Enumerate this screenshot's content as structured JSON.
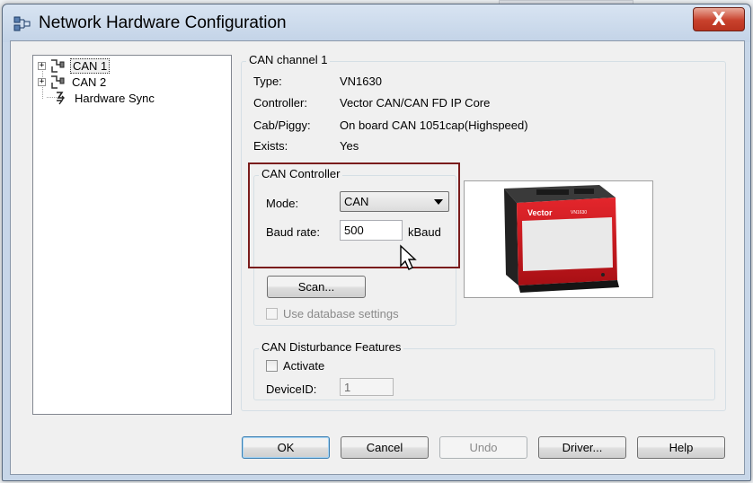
{
  "window": {
    "title": "Network Hardware Configuration",
    "close_symbol": "X"
  },
  "tree": {
    "items": [
      {
        "label": "CAN 1",
        "expander": "+",
        "icon": "can-channel-icon",
        "selected": true
      },
      {
        "label": "CAN 2",
        "expander": "+",
        "icon": "can-channel-icon",
        "selected": false
      },
      {
        "label": "Hardware Sync",
        "expander": "",
        "icon": "hardware-sync-icon",
        "selected": false
      }
    ]
  },
  "channel": {
    "title": "CAN channel 1",
    "type_label": "Type:",
    "type_value": "VN1630",
    "controller_label": "Controller:",
    "controller_value": "Vector CAN/CAN FD IP Core",
    "cab_label": "Cab/Piggy:",
    "cab_value": "On board CAN 1051cap(Highspeed)",
    "exists_label": "Exists:",
    "exists_value": "Yes"
  },
  "can_controller": {
    "title": "CAN Controller",
    "mode_label": "Mode:",
    "mode_value": "CAN",
    "baud_label": "Baud rate:",
    "baud_value": "500",
    "baud_unit": "kBaud",
    "scan_button": "Scan...",
    "use_db_label": "Use database settings",
    "use_db_checked": false
  },
  "disturbance": {
    "title": "CAN Disturbance Features",
    "activate_label": "Activate",
    "activate_checked": false,
    "device_id_label": "DeviceID:",
    "device_id_value": "1"
  },
  "device_image": {
    "brand_text": "Vector",
    "model_text": "VN1630"
  },
  "footer": {
    "ok": "OK",
    "cancel": "Cancel",
    "undo": "Undo",
    "driver": "Driver...",
    "help": "Help"
  },
  "colors": {
    "highlight_border": "#7a1c1c",
    "close_button": "#c8412c",
    "device_red": "#d0141c"
  }
}
